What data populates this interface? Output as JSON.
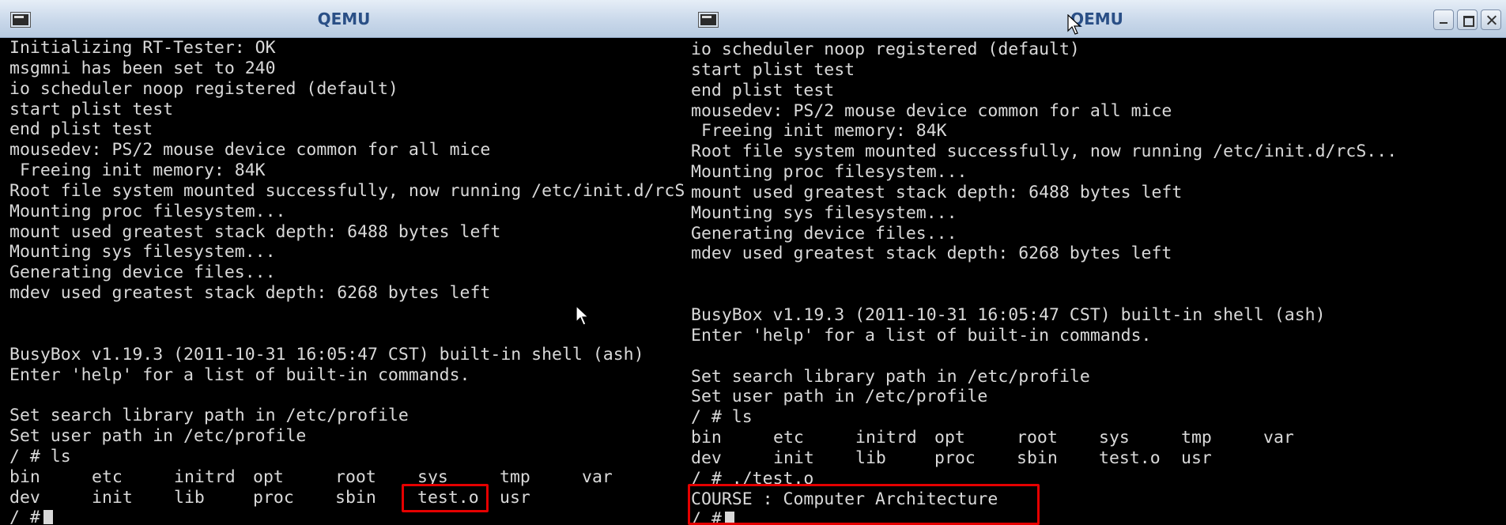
{
  "left_window": {
    "title": "QEMU",
    "lines": [
      "Initializing RT-Tester: OK",
      "msgmni has been set to 240",
      "io scheduler noop registered (default)",
      "start plist test",
      "end plist test",
      "mousedev: PS/2 mouse device common for all mice",
      " Freeing init memory: 84K",
      "Root file system mounted successfully, now running /etc/init.d/rcS...",
      "Mounting proc filesystem...",
      "mount used greatest stack depth: 6488 bytes left",
      "Mounting sys filesystem...",
      "Generating device files...",
      "mdev used greatest stack depth: 6268 bytes left",
      "",
      "",
      "BusyBox v1.19.3 (2011-10-31 16:05:47 CST) built-in shell (ash)",
      "Enter 'help' for a list of built-in commands.",
      "",
      "Set search library path in /etc/profile",
      "Set user path in /etc/profile",
      "/ # ls"
    ],
    "ls_row_1": [
      "bin",
      "etc",
      "initrd",
      "opt",
      "root",
      "sys",
      "tmp",
      "var"
    ],
    "ls_row_2": [
      "dev",
      "init",
      "lib",
      "proc",
      "sbin",
      "test.o",
      "usr"
    ],
    "prompt": "/ #",
    "highlighted_item": "test.o"
  },
  "right_window": {
    "title": "QEMU",
    "lines": [
      "io scheduler noop registered (default)",
      "start plist test",
      "end plist test",
      "mousedev: PS/2 mouse device common for all mice",
      " Freeing init memory: 84K",
      "Root file system mounted successfully, now running /etc/init.d/rcS...",
      "Mounting proc filesystem...",
      "mount used greatest stack depth: 6488 bytes left",
      "Mounting sys filesystem...",
      "Generating device files...",
      "mdev used greatest stack depth: 6268 bytes left",
      "",
      "",
      "BusyBox v1.19.3 (2011-10-31 16:05:47 CST) built-in shell (ash)",
      "Enter 'help' for a list of built-in commands.",
      "",
      "Set search library path in /etc/profile",
      "Set user path in /etc/profile",
      "/ # ls"
    ],
    "ls_row_1": [
      "bin",
      "etc",
      "initrd",
      "opt",
      "root",
      "sys",
      "tmp",
      "var"
    ],
    "ls_row_2": [
      "dev",
      "init",
      "lib",
      "proc",
      "sbin",
      "test.o",
      "usr"
    ],
    "run_command": "/ # ./test.o",
    "program_output": "COURSE : Computer Architecture",
    "prompt": "/ #"
  },
  "colors": {
    "console_bg": "#000000",
    "console_fg": "#d9d9d9",
    "title_text": "#2a4f86",
    "annotation_red": "#e50000"
  }
}
